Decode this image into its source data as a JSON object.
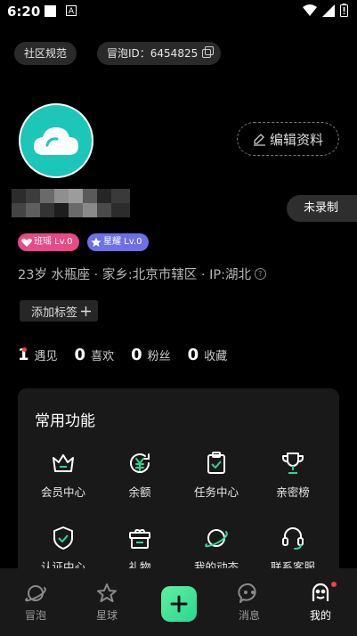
{
  "status_bar": {
    "time": "6:20",
    "a_label": "A"
  },
  "top": {
    "rules_chip": "社区规范",
    "id_chip": "冒泡ID：6454825"
  },
  "profile": {
    "edit_label": "编辑资料",
    "record_label": "未录制",
    "badges": [
      {
        "label": "班瑶 Lv.0",
        "color": "#e74a86",
        "icon": "heart-icon"
      },
      {
        "label": "星耀 Lv.0",
        "color": "#6c71e6",
        "icon": "star-icon"
      }
    ],
    "info": "23岁 水瓶座 · 家乡:北京市辖区 · IP:湖北",
    "add_tag_label": "添加标签"
  },
  "stats": [
    {
      "num": "1",
      "label": "遇见"
    },
    {
      "num": "0",
      "label": "喜欢"
    },
    {
      "num": "0",
      "label": "粉丝"
    },
    {
      "num": "0",
      "label": "收藏"
    }
  ],
  "features": {
    "title": "常用功能",
    "items": [
      {
        "label": "会员中心",
        "icon": "crown-icon"
      },
      {
        "label": "余额",
        "icon": "yen-icon"
      },
      {
        "label": "任务中心",
        "icon": "clipboard-check-icon"
      },
      {
        "label": "亲密榜",
        "icon": "trophy-icon"
      },
      {
        "label": "认证中心",
        "icon": "shield-check-icon"
      },
      {
        "label": "礼物",
        "icon": "gift-icon"
      },
      {
        "label": "我的动态",
        "icon": "planet-icon"
      },
      {
        "label": "联系客服",
        "icon": "headset-icon"
      }
    ]
  },
  "nav": [
    {
      "label": "冒泡",
      "icon": "planet-icon"
    },
    {
      "label": "星球",
      "icon": "star-icon"
    },
    {
      "label": "",
      "icon": "plus-icon"
    },
    {
      "label": "消息",
      "icon": "message-icon"
    },
    {
      "label": "我的",
      "icon": "profile-icon"
    }
  ],
  "colors": {
    "avatar": "#1cc6b9",
    "accent_green": "#2ad690",
    "dot_red": "#ff3b3b"
  }
}
